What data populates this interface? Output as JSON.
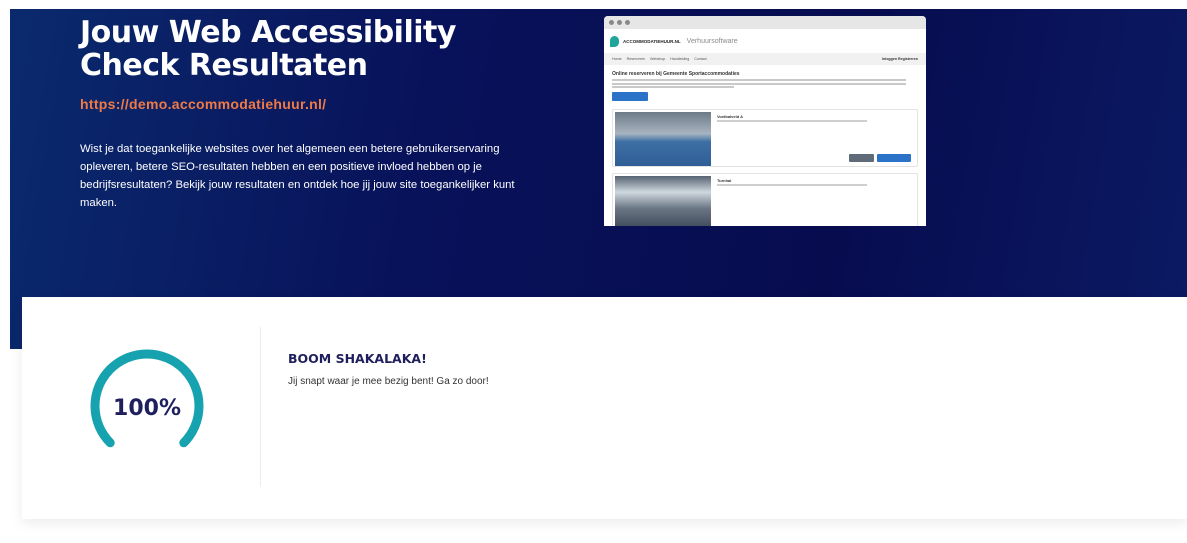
{
  "hero": {
    "title": "Jouw Web Accessibility Check Resultaten",
    "url": "https://demo.accommodatiehuur.nl/",
    "description": "Wist je dat toegankelijke websites over het algemeen een betere gebruikerservaring opleveren, betere SEO-resultaten hebben en een positieve invloed hebben op je bedrijfsresultaten? Bekijk jouw resultaten en ontdek hoe jij jouw site toegankelijker kunt maken."
  },
  "screenshot": {
    "brand": "ACCOMMODATIEHUUR.NL",
    "subtitle": "Verhuursoftware",
    "nav": [
      "Home",
      "Reserveren",
      "Webshop",
      "Handleiding",
      "Contact"
    ],
    "nav_right": "Inloggen  Registreren",
    "heading": "Online reserveren bij Gemeente Sportaccommodaties",
    "card1_title": "Voetbalveld A",
    "card2_title": "Turnhal"
  },
  "result": {
    "score": 100,
    "score_label": "100%",
    "title": "BOOM SHAKALAKA!",
    "text": "Jij snapt waar je mee bezig bent! Ga zo door!",
    "gauge_color": "#17a2b0"
  },
  "colors": {
    "hero_bg": "#08125a",
    "accent": "#ef7a45",
    "heading": "#1e1f5c"
  }
}
